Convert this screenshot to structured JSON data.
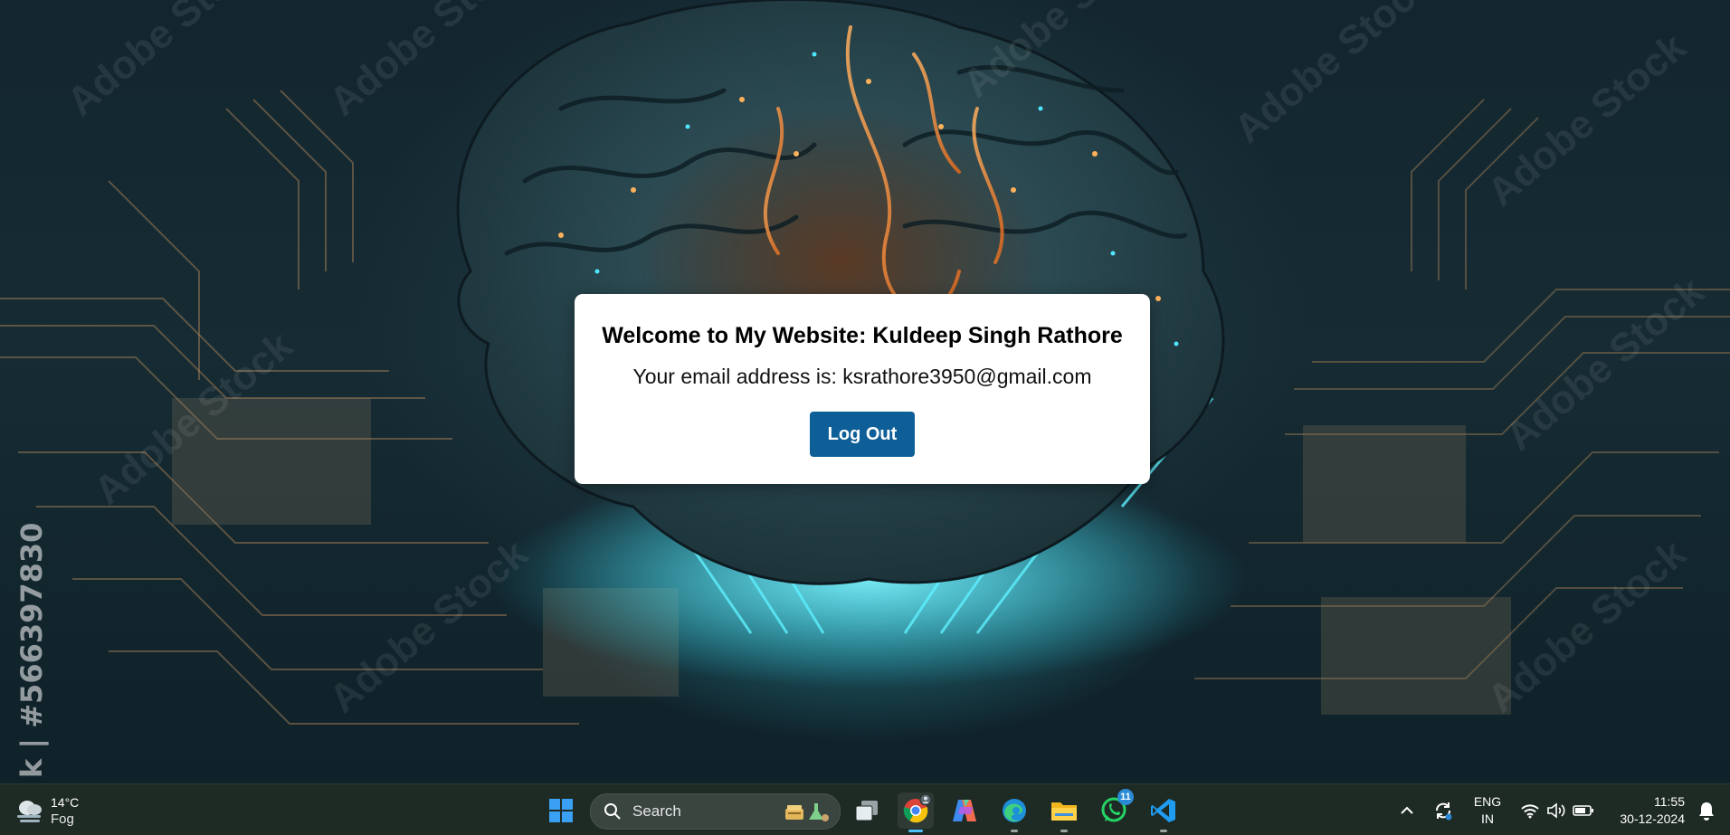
{
  "card": {
    "title": "Welcome to My Website: Kuldeep Singh Rathore",
    "email_line": "Your email address is: ksrathore3950@gmail.com",
    "logout_label": "Log Out"
  },
  "background": {
    "watermark_text": "Adobe Stock",
    "side_text": "k | #566397830"
  },
  "taskbar": {
    "weather": {
      "temp": "14°C",
      "condition": "Fog",
      "icon": "fog-cloud-icon"
    },
    "search_label": "Search",
    "apps": [
      {
        "name": "windows-start-icon"
      },
      {
        "name": "task-view-icon"
      },
      {
        "name": "chrome-icon",
        "active": true
      },
      {
        "name": "copilot-icon"
      },
      {
        "name": "edge-icon"
      },
      {
        "name": "file-explorer-icon"
      },
      {
        "name": "whatsapp-icon",
        "badge": "11"
      },
      {
        "name": "vscode-icon"
      }
    ],
    "tray": {
      "lang_line1": "ENG",
      "lang_line2": "IN",
      "time": "11:55",
      "date": "30-12-2024"
    }
  },
  "colors": {
    "button_blue": "#0e5f98",
    "taskbar_bg": "#1e2a24",
    "accent": "#4cc2ff"
  }
}
